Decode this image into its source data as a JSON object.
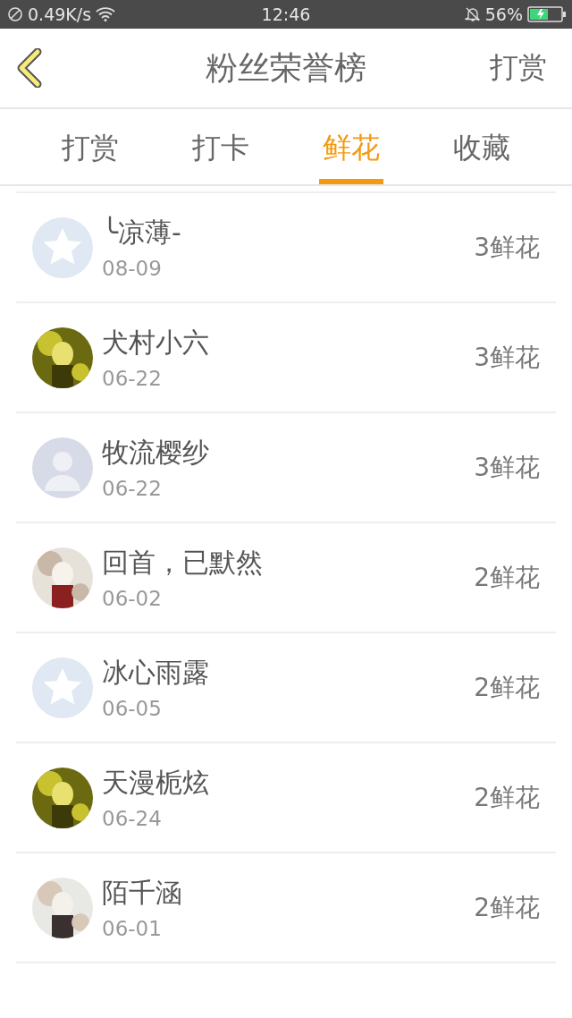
{
  "status_bar": {
    "network_speed": "0.49K/s",
    "time": "12:46",
    "battery": "56%"
  },
  "header": {
    "title": "粉丝荣誉榜",
    "action": "打赏"
  },
  "tabs": [
    {
      "label": "打赏",
      "selected": false
    },
    {
      "label": "打卡",
      "selected": false
    },
    {
      "label": "鲜花",
      "selected": true
    },
    {
      "label": "收藏",
      "selected": false
    }
  ],
  "fans": [
    {
      "name": "╰凉薄-",
      "date": "08-09",
      "amount": "3鲜花",
      "avatar": {
        "kind": "default"
      }
    },
    {
      "name": "犬村小六",
      "date": "06-22",
      "amount": "3鲜花"
    },
    {
      "name": "牧流樱纱",
      "date": "06-22",
      "amount": "3鲜花",
      "avatar": {
        "kind": "silhouette"
      }
    },
    {
      "name": "回首，已默然",
      "date": "06-02",
      "amount": "2鲜花"
    },
    {
      "name": "冰心雨露",
      "date": "06-05",
      "amount": "2鲜花",
      "avatar": {
        "kind": "default"
      }
    },
    {
      "name": "天漫栀炫",
      "date": "06-24",
      "amount": "2鲜花"
    },
    {
      "name": "陌千涵",
      "date": "06-01",
      "amount": "2鲜花"
    }
  ]
}
